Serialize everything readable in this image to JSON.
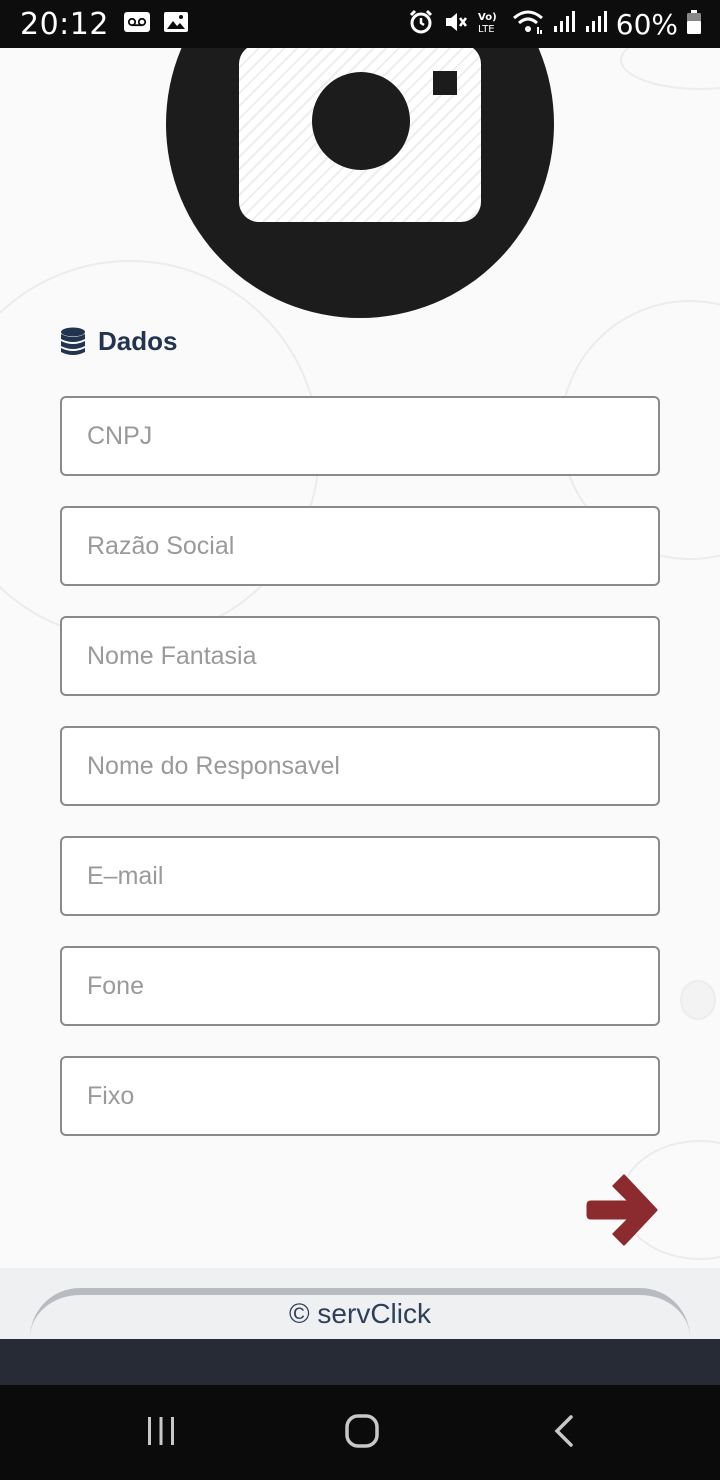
{
  "status_bar": {
    "time": "20:12",
    "battery_percent": "60%",
    "left_icons": [
      "voicemail-icon",
      "image-icon"
    ],
    "right_icons": [
      "alarm-icon",
      "mute-icon",
      "volte-icon",
      "wifi-icon",
      "signal-icon",
      "signal-icon",
      "battery-icon"
    ]
  },
  "profile": {
    "photo_icon": "camera-icon"
  },
  "section": {
    "icon": "database-icon",
    "title": "Dados"
  },
  "form": {
    "fields": [
      {
        "placeholder": "CNPJ",
        "value": ""
      },
      {
        "placeholder": "Razão Social",
        "value": ""
      },
      {
        "placeholder": "Nome Fantasia",
        "value": ""
      },
      {
        "placeholder": "Nome do Responsavel",
        "value": ""
      },
      {
        "placeholder": "E–mail",
        "value": ""
      },
      {
        "placeholder": "Fone",
        "value": ""
      },
      {
        "placeholder": "Fixo",
        "value": ""
      }
    ],
    "next_icon": "arrow-right-icon"
  },
  "footer": {
    "copyright": "© servClick"
  },
  "nav_bar": {
    "recents_icon": "recents-icon",
    "home_icon": "home-icon",
    "back_icon": "back-icon"
  },
  "colors": {
    "accent_arrow": "#8b2b2f",
    "title_text": "#22344f",
    "avatar_bg": "#1c1c1c"
  }
}
